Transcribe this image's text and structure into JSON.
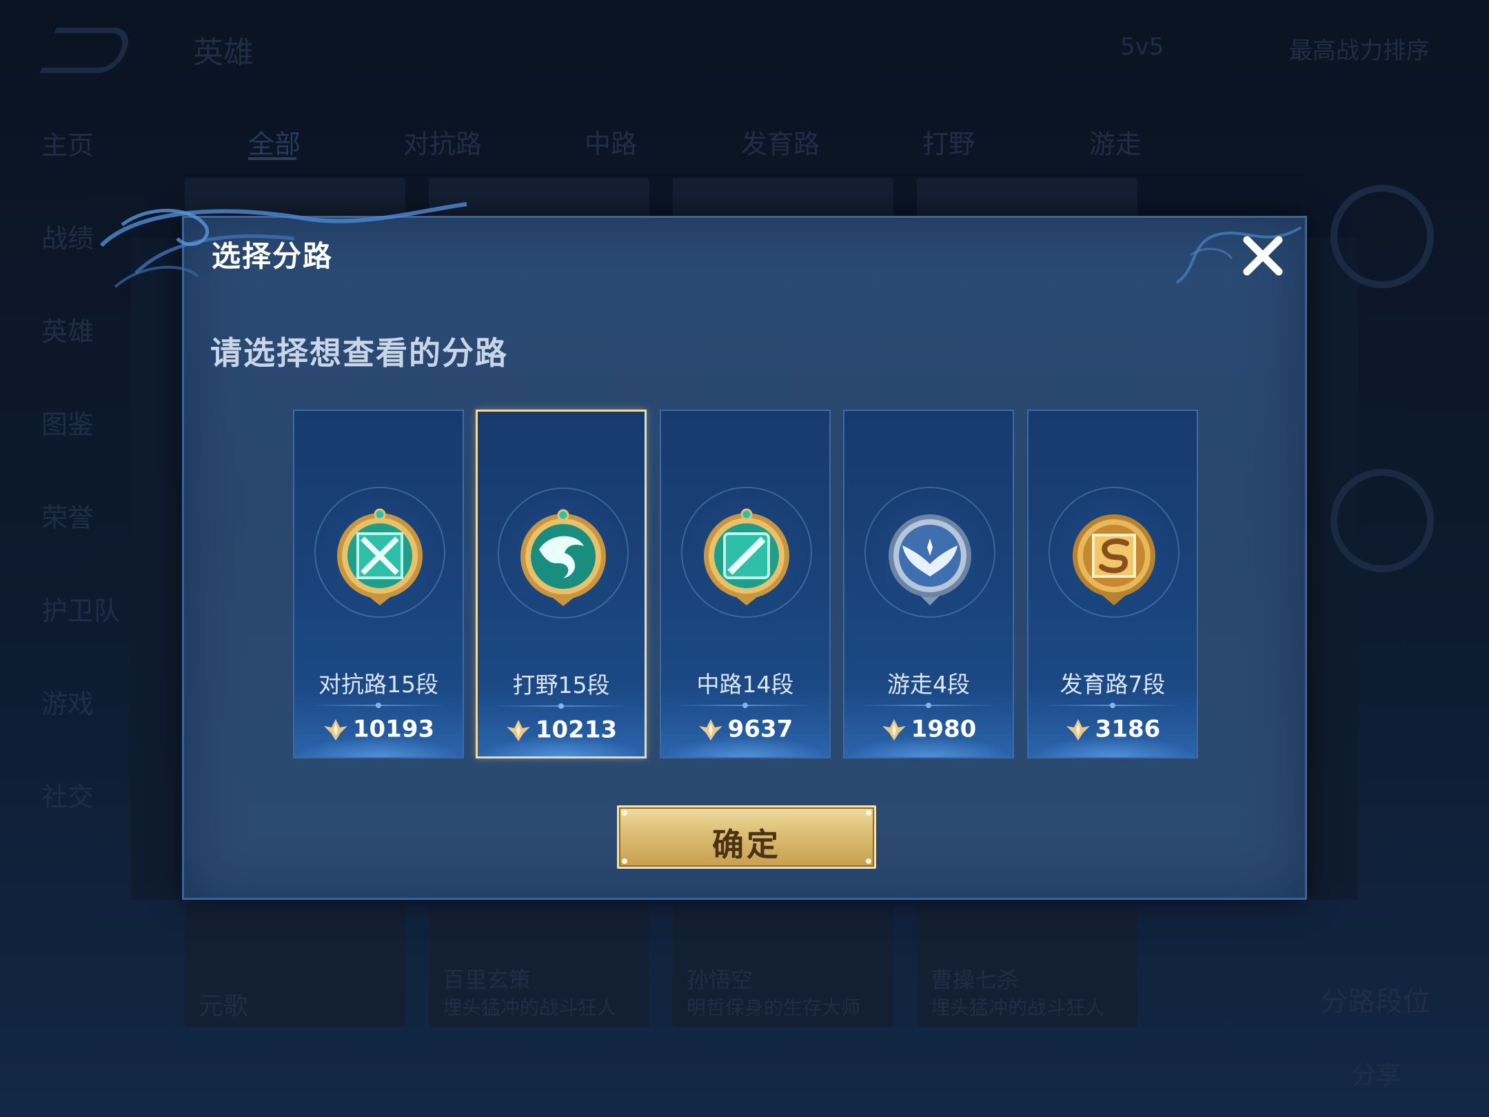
{
  "background": {
    "top_nav": {
      "title": "英雄",
      "mode": "5v5",
      "sort": "最高战力排序"
    },
    "sidebar": [
      "主页",
      "战绩",
      "英雄",
      "图鉴",
      "荣誉",
      "护卫队",
      "游戏",
      "社交"
    ],
    "tabs": [
      "全部",
      "对抗路",
      "中路",
      "发育路",
      "打野",
      "游走"
    ],
    "hero_cards": [
      {
        "name": "元歌",
        "desc": ""
      },
      {
        "name": "百里玄策",
        "desc": "埋头猛冲的战斗狂人"
      },
      {
        "name": "孙悟空",
        "desc": "明哲保身的生存大师"
      },
      {
        "name": "曹操七杀",
        "desc": "埋头猛冲的战斗狂人"
      }
    ],
    "right_panel": {
      "title": "分路段位",
      "share": "分享"
    }
  },
  "modal": {
    "title": "选择分路",
    "subtitle": "请选择想查看的分路",
    "close_icon": "close-icon",
    "confirm_label": "确定",
    "lanes": [
      {
        "label": "对抗路15段",
        "power": "10193",
        "icon": "clash-lane-medal-icon",
        "color": "#2fbfa8",
        "selected": false
      },
      {
        "label": "打野15段",
        "power": "10213",
        "icon": "jungle-dragon-medal-icon",
        "color": "#2fbfa8",
        "selected": true
      },
      {
        "label": "中路14段",
        "power": "9637",
        "icon": "mid-lane-medal-icon",
        "color": "#2fbfa8",
        "selected": false
      },
      {
        "label": "游走4段",
        "power": "1980",
        "icon": "roam-wings-medal-icon",
        "color": "#5b8fd0",
        "selected": false
      },
      {
        "label": "发育路7段",
        "power": "3186",
        "icon": "farm-lane-medal-icon",
        "color": "#e0a64a",
        "selected": false
      }
    ]
  },
  "colors": {
    "accent_gold": "#dcbd73",
    "selected_border": "#f2d9a6",
    "modal_bg": "#2a4a74"
  }
}
